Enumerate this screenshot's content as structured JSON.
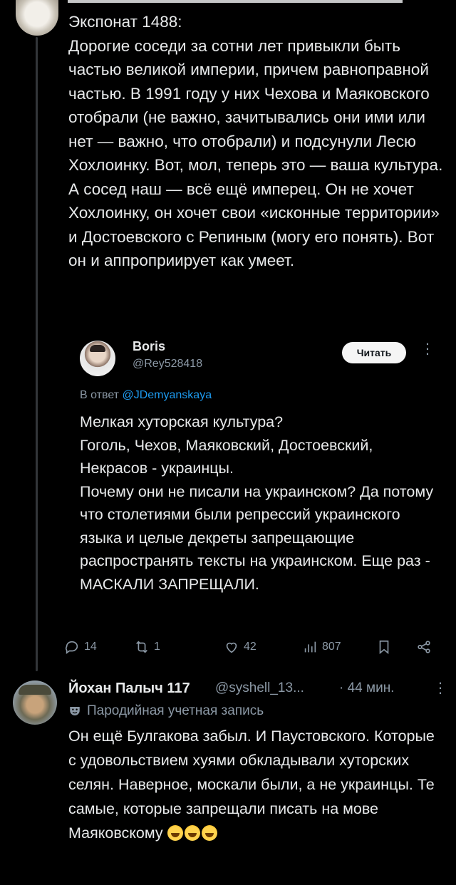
{
  "post": {
    "text": "Экспонат 1488:\nДорогие соседи за сотни лет привыкли быть частью великой империи, причем равноправной частью. В 1991 году у них Чехова и Маяковского отобрали (не важно, зачитывались они ими или нет — важно, что отобрали) и подсунули Лесю Хохлоинку. Вот, мол, теперь это — ваша культура. А сосед наш — всё ещё имперец. Он не хочет Хохлоинку, он хочет свои «исконные территории» и Достоевского с Репиным (могу его понять). Вот он и аппроприирует как умеет."
  },
  "quoted": {
    "name": "Boris",
    "handle": "@Rey528418",
    "follow_label": "Читать",
    "reply_prefix": "В ответ",
    "reply_mention": "@JDemyanskaya",
    "text": "Мелкая хуторская культура?\nГоголь, Чехов, Маяковский, Достоевский, Некрасов - украинцы.\nПочему они не писали на украинском? Да потому что столетиями были репрессий украинского языка и целые декреты запрещающие распространять тексты на украинском. Еще раз - МАСКАЛИ ЗАПРЕЩАЛИ."
  },
  "actions": {
    "replies": "14",
    "reposts": "1",
    "likes": "42",
    "views": "807"
  },
  "reply": {
    "name": "Йохан Палыч 117",
    "handle": "@syshell_13...",
    "time": "· 44 мин.",
    "parody_label": "Пародийная учетная запись",
    "text": "Он ещё Булгакова забыл. И Паустовского. Которые с удовольствием хуями обкладывали хуторских селян. Наверное, москали были, а не украинцы. Те самые, которые запрещали писать на мове Маяковскому"
  },
  "icons": {
    "reply": "speech-bubble-icon",
    "repost": "repost-arrows-icon",
    "like": "heart-icon",
    "views": "bar-chart-icon",
    "bookmark": "bookmark-icon",
    "share": "share-icon",
    "parody": "mask-icon",
    "emoji": "face-with-tears-of-joy"
  },
  "colors": {
    "background": "#000000",
    "text": "#e7e9ea",
    "muted": "#8b98a5",
    "link": "#1d9bf0"
  }
}
